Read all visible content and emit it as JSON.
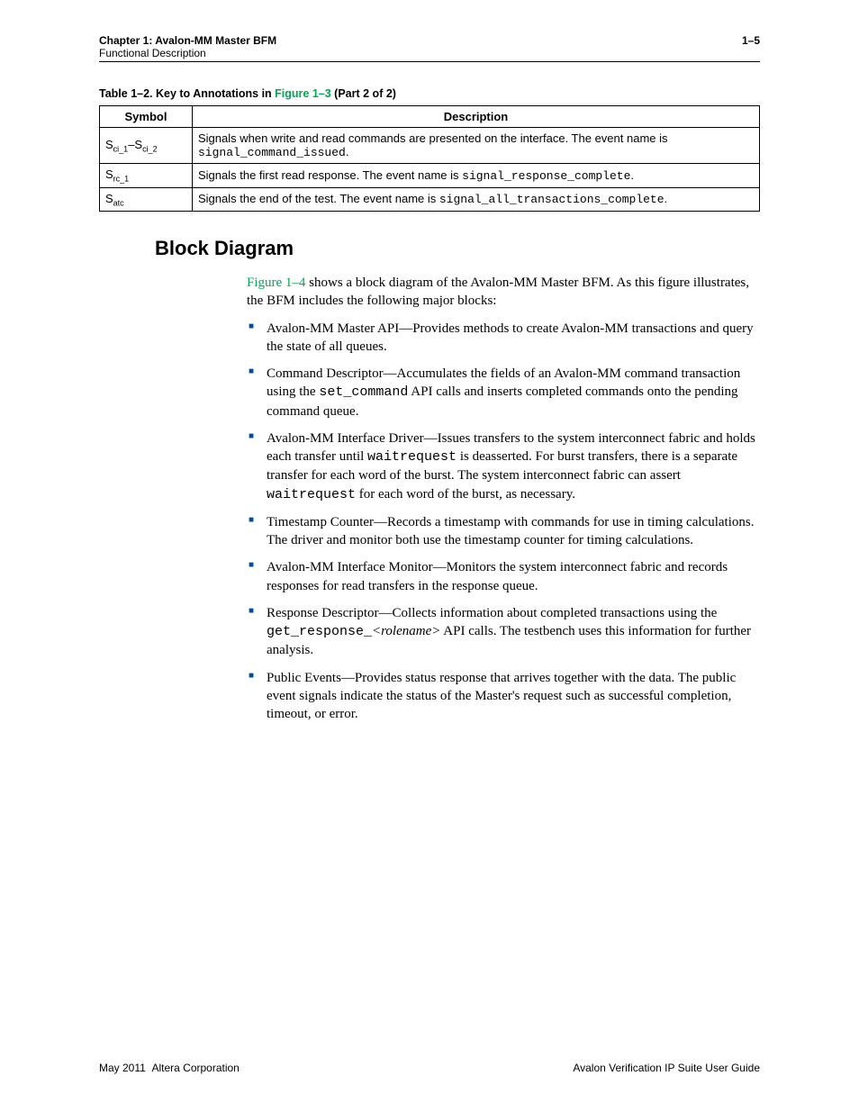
{
  "header": {
    "chapter": "Chapter 1: Avalon-MM Master BFM",
    "section": "Functional Description",
    "page_number": "1–5"
  },
  "table": {
    "caption_prefix": "Table 1–2. Key to Annotations in ",
    "caption_figure": "Figure 1–3",
    "caption_suffix": "  (Part 2 of 2)",
    "headers": {
      "symbol": "Symbol",
      "description": "Description"
    },
    "rows": [
      {
        "symbol_html": "S<span class='sub'>ci_1</span>–S<span class='sub'>ci_2</span>",
        "description_html": "Signals when write and read commands are presented on the interface. The event name is <span class='code-name'>signal_command_issued</span>."
      },
      {
        "symbol_html": "S<span class='sub'>rc_1</span>",
        "description_html": "Signals the first read response. The event name is <span class='code-name'>signal_response_complete</span>."
      },
      {
        "symbol_html": "S<span class='sub'>atc</span>",
        "description_html": "Signals the end of the test. The event name is <span class='code-name'>signal_all_transactions_complete</span>."
      }
    ]
  },
  "section_heading": "Block Diagram",
  "intro": {
    "figure_ref": "Figure 1–4",
    "rest": " shows a block diagram of the Avalon-MM Master BFM. As this figure illustrates, the BFM includes the following major blocks:"
  },
  "bullets": [
    "Avalon-MM Master API—Provides methods to create Avalon-MM transactions and query the state of all queues.",
    "Command Descriptor—Accumulates the fields of an Avalon-MM command transaction using the <span class='code-name'>set_command</span> API calls and inserts completed commands onto the pending command queue.",
    "Avalon-MM Interface Driver—Issues transfers to the system interconnect fabric and holds each transfer until <span class='code-name'>waitrequest</span> is deasserted. For burst transfers, there is a separate transfer for each word of the burst. The system interconnect fabric can assert <span class='code-name'>waitrequest</span> for each word of the burst, as necessary.",
    "Timestamp Counter—Records a timestamp with commands for use in timing calculations. The driver and monitor both use the timestamp counter for timing calculations.",
    "Avalon-MM Interface Monitor—Monitors the system interconnect fabric and records responses for read transfers in the response queue.",
    "Response Descriptor—Collects information about completed transactions using the <span class='code-name'>get_response_</span><span class='italic'>&lt;rolename&gt;</span> API calls. The testbench uses this information for further analysis.",
    "Public Events—Provides status response that arrives together with the data. The public event signals indicate the status of the Master's request such as successful completion, timeout, or error."
  ],
  "footer": {
    "left": "May 2011  Altera Corporation",
    "right": "Avalon Verification IP Suite User Guide"
  }
}
